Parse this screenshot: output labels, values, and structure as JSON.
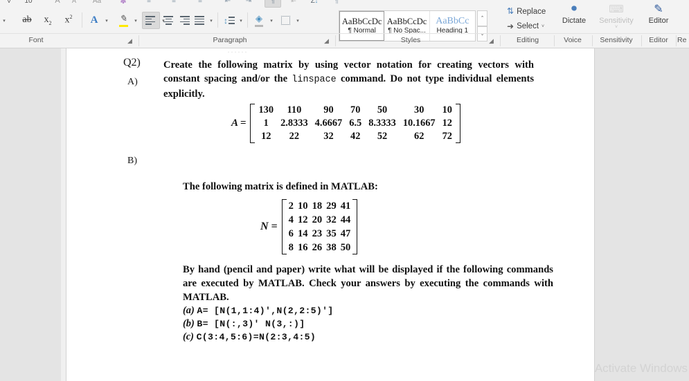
{
  "ribbon": {
    "groups": [
      {
        "name": "Font",
        "label": "Font",
        "has_launcher": true
      },
      {
        "name": "Paragraph",
        "label": "Paragraph",
        "has_launcher": true
      },
      {
        "name": "Styles",
        "label": "Styles",
        "has_launcher": true
      },
      {
        "name": "Editing",
        "label": "Editing",
        "has_launcher": false
      },
      {
        "name": "Voice",
        "label": "Voice",
        "has_launcher": false
      },
      {
        "name": "Sensitivity",
        "label": "Sensitivity",
        "has_launcher": false,
        "disabled": true
      },
      {
        "name": "Editor",
        "label": "Editor",
        "has_launcher": false
      },
      {
        "name": "Reuse",
        "label": "Re",
        "has_launcher": false
      }
    ],
    "font_group": {
      "font_size_value": "10",
      "strikethrough_label": "ab",
      "subscript_label": "x",
      "subscript_sub": "2",
      "superscript_label": "x",
      "superscript_sup": "2",
      "text_effects_label": "A",
      "highlight_label": "A",
      "font_color_label": "A"
    },
    "paragraph_group": {
      "align_left_label": "",
      "align_center_label": "",
      "align_right_label": "",
      "justify_label": "",
      "line_spacing_label": "",
      "shading_label": "",
      "borders_label": "",
      "sort_label": "Z",
      "show_marks_label": "¶"
    },
    "styles_group": {
      "items": [
        {
          "preview": "AaBbCcDc",
          "name": "¶ Normal",
          "selected": true
        },
        {
          "preview": "AaBbCcDc",
          "name": "¶ No Spac...",
          "selected": false
        },
        {
          "preview": "AaBbCс",
          "name": "Heading 1",
          "selected": false
        }
      ],
      "scroll_up": "⌃",
      "scroll_down": "⌄"
    },
    "editing_group": {
      "replace_label": "Replace",
      "select_label": "Select",
      "select_caret": "˅"
    },
    "voice_group": {
      "dictate_label": "Dictate"
    },
    "sensitivity_group": {
      "sensitivity_label": "Sensitivity",
      "caret": "˅"
    },
    "editor_group": {
      "editor_label": "Editor"
    }
  },
  "document": {
    "smudge_text": "······",
    "q2_label": "Q2)",
    "a_label": "A)",
    "b_label": "B)",
    "part_a": {
      "text_before_code": "Create the following matrix by using vector notation for creating vectors with constant spacing and/or the ",
      "code": "linspace",
      "text_after_code": " command. Do not type individual elements explicitly."
    },
    "matrix_a": {
      "name": "A =",
      "rows": [
        [
          "130",
          "110",
          "90",
          "70",
          "50",
          "30",
          "10"
        ],
        [
          "1",
          "2.8333",
          "4.6667",
          "6.5",
          "8.3333",
          "10.1667",
          "12"
        ],
        [
          "12",
          "22",
          "32",
          "42",
          "52",
          "62",
          "72"
        ]
      ]
    },
    "part_b": {
      "intro": "The following matrix is defined in MATLAB:",
      "matrix_n": {
        "name": "N =",
        "rows": [
          [
            "2",
            "10",
            "18",
            "29",
            "41"
          ],
          [
            "4",
            "12",
            "20",
            "32",
            "44"
          ],
          [
            "6",
            "14",
            "23",
            "35",
            "47"
          ],
          [
            "8",
            "16",
            "26",
            "38",
            "50"
          ]
        ]
      },
      "body": "By hand (pencil and paper) write what will be displayed if the following commands are executed by MATLAB. Check your answers by executing the commands with MATLAB.",
      "commands": [
        {
          "label": "(a)",
          "code": "A= [N(1,1:4)',N(2,2:5)']"
        },
        {
          "label": "(b)",
          "code": "B= [N(:,3)' N(3,:)]"
        },
        {
          "label": "(c)",
          "code": "C(3:4,5:6)=N(2:3,4:5)"
        }
      ]
    }
  },
  "watermark": {
    "text": "Activate Windows"
  },
  "colors": {
    "ribbon_bg": "#f3f3f3",
    "page_bg": "#ffffff",
    "canvas_bg": "#e4e4e4",
    "heading_blue": "#7ba7d7",
    "watermark_grey": "#d3d3d3"
  }
}
